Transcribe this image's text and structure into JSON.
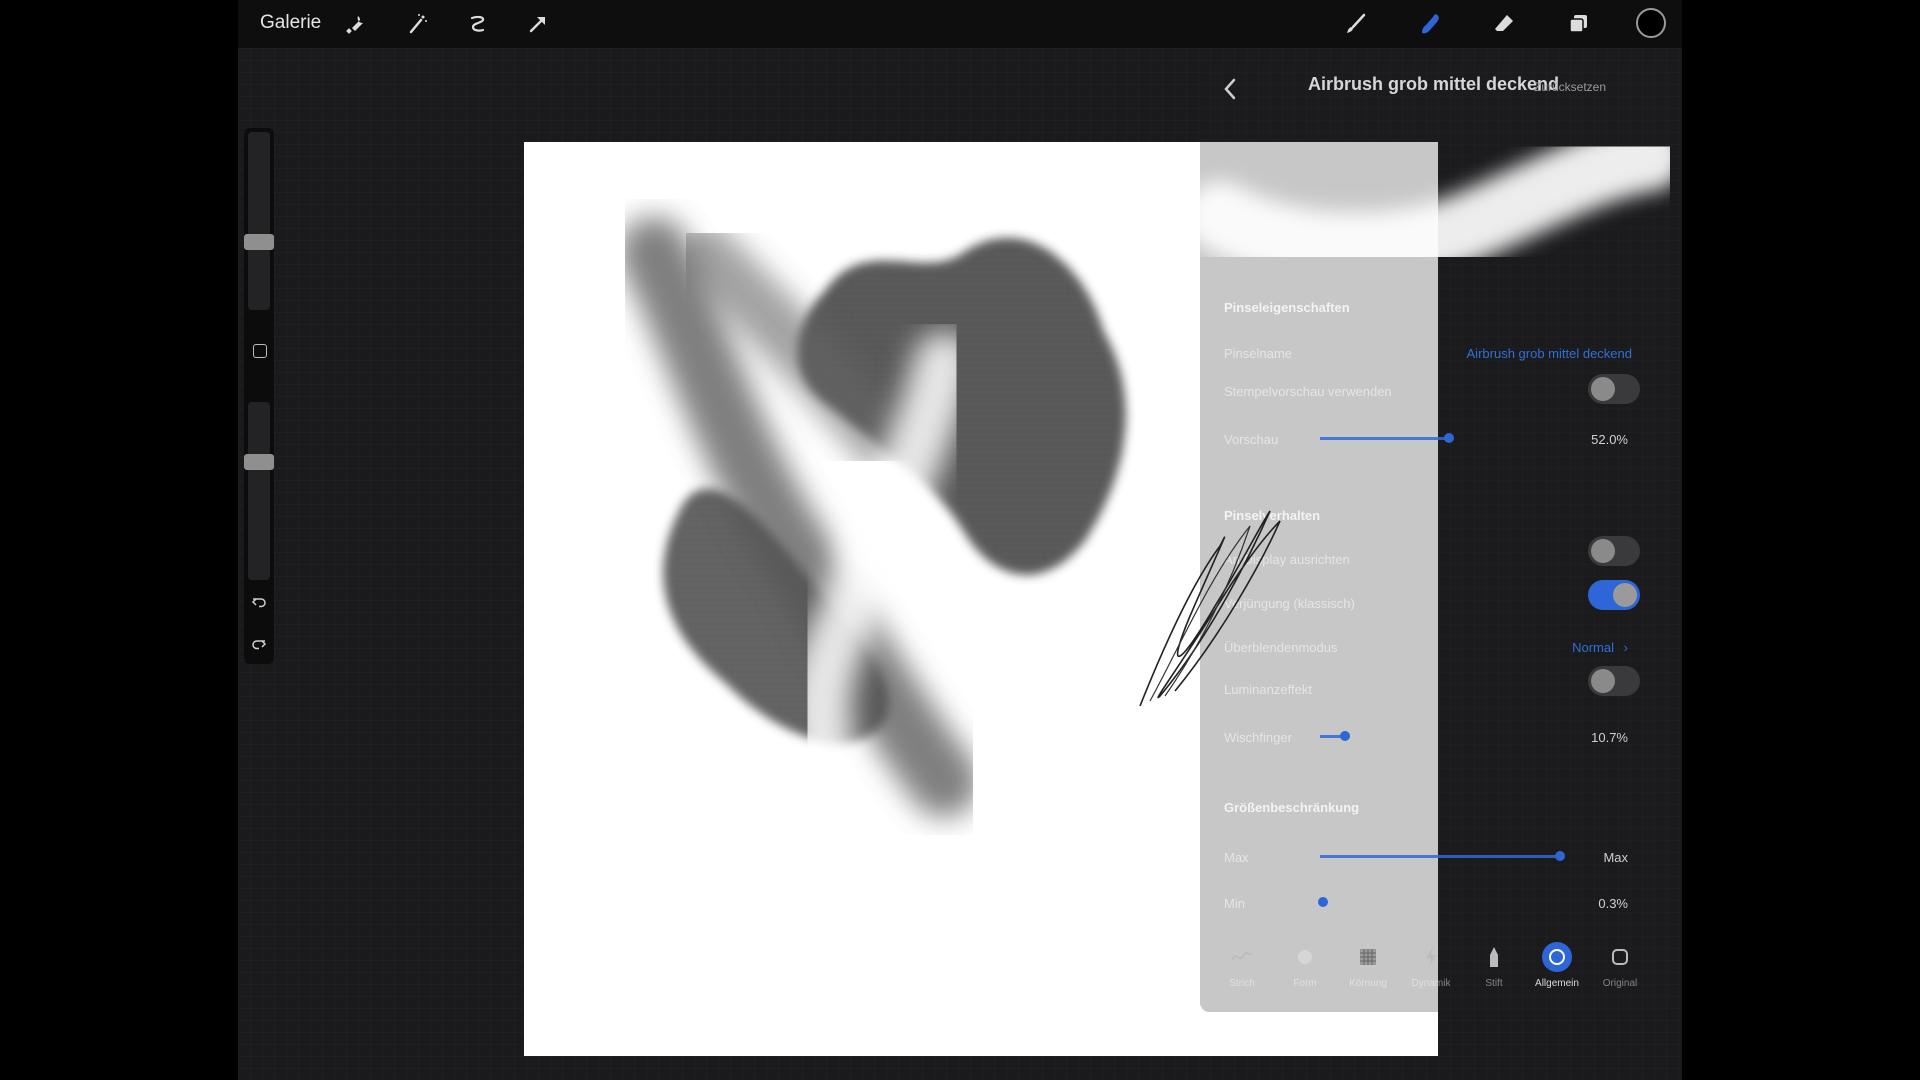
{
  "topbar": {
    "gallery_label": "Galerie",
    "left_icons": [
      "wrench-icon",
      "magic-wand-icon",
      "selection-icon",
      "transform-arrow-icon"
    ],
    "right_icons": [
      "brush-icon",
      "smudge-icon",
      "eraser-icon",
      "layers-icon"
    ],
    "accent": "#2e66d8"
  },
  "panel": {
    "title": "Airbrush grob mittel deckend",
    "reset_label": "Zurücksetzen",
    "sections": {
      "brush_properties": {
        "heading": "Pinseleigenschaften",
        "brush_name_label": "Pinselname",
        "brush_name_value": "Airbrush grob mittel deckend",
        "stamp_preview_label": "Stempelvorschau verwenden",
        "stamp_preview_on": false,
        "preview_label": "Vorschau",
        "preview_value": "52.0%"
      },
      "brush_behavior": {
        "heading": "Pinselverhalten",
        "align_display_label": "An Display ausrichten",
        "align_display_on": false,
        "taper_label": "Verjüngung (klassisch)",
        "taper_on": true,
        "blend_mode_label": "Überblendenmodus",
        "blend_mode_value": "Normal",
        "luminance_label": "Luminanzeffekt",
        "luminance_on": false,
        "smudge_label": "Wischfinger",
        "smudge_value": "10.7%"
      },
      "size_limits": {
        "heading": "Größenbeschränkung",
        "max_label": "Max",
        "max_value": "Max",
        "min_label": "Min",
        "min_value": "0.3%"
      }
    },
    "tabs": [
      {
        "label": "Strich",
        "icon": "stroke-icon"
      },
      {
        "label": "Form",
        "icon": "shape-icon"
      },
      {
        "label": "Körnung",
        "icon": "grain-icon"
      },
      {
        "label": "Dynamik",
        "icon": "dynamics-icon"
      },
      {
        "label": "Stift",
        "icon": "pencil-icon"
      },
      {
        "label": "Allgemein",
        "icon": "general-icon"
      },
      {
        "label": "Original",
        "icon": "source-icon"
      }
    ],
    "active_tab": "Allgemein"
  }
}
